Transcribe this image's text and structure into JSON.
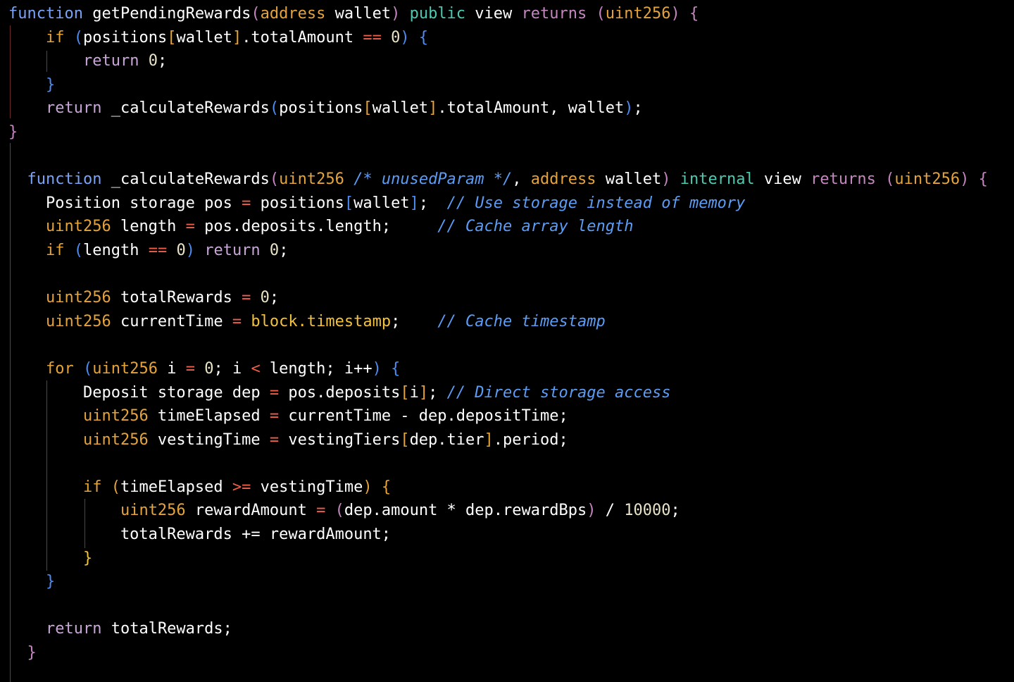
{
  "editor": {
    "language": "solidity",
    "background": "#000000",
    "colors": {
      "keyword": "#7aa2f7",
      "type": "#e5a33b",
      "modifier": "#4ec9b0",
      "operator": "#f05f4a",
      "comment": "#5c9cf5",
      "number": "#e9e3c8",
      "text": "#ffffff"
    },
    "lines": [
      [
        [
          "function",
          "t-kw"
        ],
        [
          " getPendingRewards",
          "t-white"
        ],
        [
          "(",
          "t-purple"
        ],
        [
          "address",
          "t-orange"
        ],
        [
          " wallet",
          "t-white"
        ],
        [
          ")",
          "t-purple"
        ],
        [
          " ",
          "t-white"
        ],
        [
          "public",
          "t-teal"
        ],
        [
          " view ",
          "t-white"
        ],
        [
          "returns",
          "t-purple"
        ],
        [
          " (",
          "t-purple"
        ],
        [
          "uint256",
          "t-orange"
        ],
        [
          ") {",
          "t-purple"
        ]
      ],
      [
        [
          "    ",
          "t-white"
        ],
        [
          "if",
          "t-orange"
        ],
        [
          " (",
          "t-blue"
        ],
        [
          "positions",
          "t-white"
        ],
        [
          "[",
          "t-orange"
        ],
        [
          "wallet",
          "t-white"
        ],
        [
          "]",
          "t-orange"
        ],
        [
          ".totalAmount ",
          "t-white"
        ],
        [
          "==",
          "t-op"
        ],
        [
          " 0",
          "t-num"
        ],
        [
          ") {",
          "t-blue"
        ]
      ],
      [
        [
          "        ",
          "t-white"
        ],
        [
          "return",
          "t-ret"
        ],
        [
          " 0",
          "t-num"
        ],
        [
          ";",
          "t-white"
        ]
      ],
      [
        [
          "    ",
          "t-white"
        ],
        [
          "}",
          "t-blue"
        ]
      ],
      [
        [
          "    ",
          "t-white"
        ],
        [
          "return",
          "t-ret"
        ],
        [
          " _calculateRewards",
          "t-white"
        ],
        [
          "(",
          "t-blue"
        ],
        [
          "positions",
          "t-white"
        ],
        [
          "[",
          "t-orange"
        ],
        [
          "wallet",
          "t-white"
        ],
        [
          "]",
          "t-orange"
        ],
        [
          ".totalAmount, wallet",
          "t-white"
        ],
        [
          ")",
          "t-blue"
        ],
        [
          ";",
          "t-white"
        ]
      ],
      [
        [
          "}",
          "t-purple"
        ]
      ],
      [
        [
          "",
          "t-white"
        ]
      ],
      [
        [
          "  ",
          "t-white"
        ],
        [
          "function",
          "t-kw"
        ],
        [
          " _calculateRewards",
          "t-white"
        ],
        [
          "(",
          "t-purple"
        ],
        [
          "uint256",
          "t-orange"
        ],
        [
          " ",
          "t-white"
        ],
        [
          "/* unusedParam */",
          "t-comment"
        ],
        [
          ", ",
          "t-white"
        ],
        [
          "address",
          "t-orange"
        ],
        [
          " wallet",
          "t-white"
        ],
        [
          ")",
          "t-purple"
        ],
        [
          " ",
          "t-white"
        ],
        [
          "internal",
          "t-teal"
        ],
        [
          " view ",
          "t-white"
        ],
        [
          "returns",
          "t-purple"
        ],
        [
          " (",
          "t-purple"
        ],
        [
          "uint256",
          "t-orange"
        ],
        [
          ") {",
          "t-purple"
        ]
      ],
      [
        [
          "    Position storage pos ",
          "t-white"
        ],
        [
          "=",
          "t-op"
        ],
        [
          " positions",
          "t-white"
        ],
        [
          "[",
          "t-blue"
        ],
        [
          "wallet",
          "t-white"
        ],
        [
          "]",
          "t-blue"
        ],
        [
          ";  ",
          "t-white"
        ],
        [
          "// Use storage instead of memory",
          "t-comment"
        ]
      ],
      [
        [
          "    ",
          "t-white"
        ],
        [
          "uint256",
          "t-orange"
        ],
        [
          " length ",
          "t-white"
        ],
        [
          "=",
          "t-op"
        ],
        [
          " pos.deposits.length;     ",
          "t-white"
        ],
        [
          "// Cache array length",
          "t-comment"
        ]
      ],
      [
        [
          "    ",
          "t-white"
        ],
        [
          "if",
          "t-orange"
        ],
        [
          " (",
          "t-blue"
        ],
        [
          "length ",
          "t-white"
        ],
        [
          "==",
          "t-op"
        ],
        [
          " 0",
          "t-num"
        ],
        [
          ")",
          "t-blue"
        ],
        [
          " ",
          "t-white"
        ],
        [
          "return",
          "t-ret"
        ],
        [
          " 0",
          "t-num"
        ],
        [
          ";",
          "t-white"
        ]
      ],
      [
        [
          "",
          "t-white"
        ]
      ],
      [
        [
          "    ",
          "t-white"
        ],
        [
          "uint256",
          "t-orange"
        ],
        [
          " totalRewards ",
          "t-white"
        ],
        [
          "=",
          "t-op"
        ],
        [
          " 0",
          "t-num"
        ],
        [
          ";",
          "t-white"
        ]
      ],
      [
        [
          "    ",
          "t-white"
        ],
        [
          "uint256",
          "t-orange"
        ],
        [
          " currentTime ",
          "t-white"
        ],
        [
          "=",
          "t-op"
        ],
        [
          " ",
          "t-white"
        ],
        [
          "block.timestamp",
          "t-yellow"
        ],
        [
          ";    ",
          "t-white"
        ],
        [
          "// Cache timestamp",
          "t-comment"
        ]
      ],
      [
        [
          "",
          "t-white"
        ]
      ],
      [
        [
          "    ",
          "t-white"
        ],
        [
          "for",
          "t-orange"
        ],
        [
          " (",
          "t-blue"
        ],
        [
          "uint256",
          "t-orange"
        ],
        [
          " i ",
          "t-white"
        ],
        [
          "=",
          "t-op"
        ],
        [
          " 0",
          "t-num"
        ],
        [
          "; i ",
          "t-white"
        ],
        [
          "<",
          "t-op"
        ],
        [
          " length; i++",
          "t-white"
        ],
        [
          ")",
          "t-blue"
        ],
        [
          " {",
          "t-blue"
        ]
      ],
      [
        [
          "        Deposit storage dep ",
          "t-white"
        ],
        [
          "=",
          "t-op"
        ],
        [
          " pos.deposits",
          "t-white"
        ],
        [
          "[",
          "t-orange"
        ],
        [
          "i",
          "t-white"
        ],
        [
          "]",
          "t-orange"
        ],
        [
          "; ",
          "t-white"
        ],
        [
          "// Direct storage access",
          "t-comment"
        ]
      ],
      [
        [
          "        ",
          "t-white"
        ],
        [
          "uint256",
          "t-orange"
        ],
        [
          " timeElapsed ",
          "t-white"
        ],
        [
          "=",
          "t-op"
        ],
        [
          " currentTime - dep.depositTime;",
          "t-white"
        ]
      ],
      [
        [
          "        ",
          "t-white"
        ],
        [
          "uint256",
          "t-orange"
        ],
        [
          " vestingTime ",
          "t-white"
        ],
        [
          "=",
          "t-op"
        ],
        [
          " vestingTiers",
          "t-white"
        ],
        [
          "[",
          "t-orange"
        ],
        [
          "dep.tier",
          "t-white"
        ],
        [
          "]",
          "t-orange"
        ],
        [
          ".period;",
          "t-white"
        ]
      ],
      [
        [
          "",
          "t-white"
        ]
      ],
      [
        [
          "        ",
          "t-white"
        ],
        [
          "if",
          "t-orange"
        ],
        [
          " (",
          "t-orange"
        ],
        [
          "timeElapsed ",
          "t-white"
        ],
        [
          ">=",
          "t-op"
        ],
        [
          " vestingTime",
          "t-white"
        ],
        [
          ")",
          "t-orange"
        ],
        [
          " {",
          "t-orange"
        ]
      ],
      [
        [
          "            ",
          "t-white"
        ],
        [
          "uint256",
          "t-orange"
        ],
        [
          " rewardAmount ",
          "t-white"
        ],
        [
          "=",
          "t-op"
        ],
        [
          " (",
          "t-purple"
        ],
        [
          "dep.amount * dep.rewardBps",
          "t-white"
        ],
        [
          ")",
          "t-purple"
        ],
        [
          " / ",
          "t-white"
        ],
        [
          "10000",
          "t-num"
        ],
        [
          ";",
          "t-white"
        ]
      ],
      [
        [
          "            totalRewards += rewardAmount;",
          "t-white"
        ]
      ],
      [
        [
          "        ",
          "t-white"
        ],
        [
          "}",
          "t-yellow"
        ]
      ],
      [
        [
          "    ",
          "t-white"
        ],
        [
          "}",
          "t-blue"
        ]
      ],
      [
        [
          "",
          "t-white"
        ]
      ],
      [
        [
          "    ",
          "t-white"
        ],
        [
          "return",
          "t-ret"
        ],
        [
          " totalRewards;",
          "t-white"
        ]
      ],
      [
        [
          "  ",
          "t-white"
        ],
        [
          "}",
          "t-purple"
        ]
      ]
    ]
  }
}
